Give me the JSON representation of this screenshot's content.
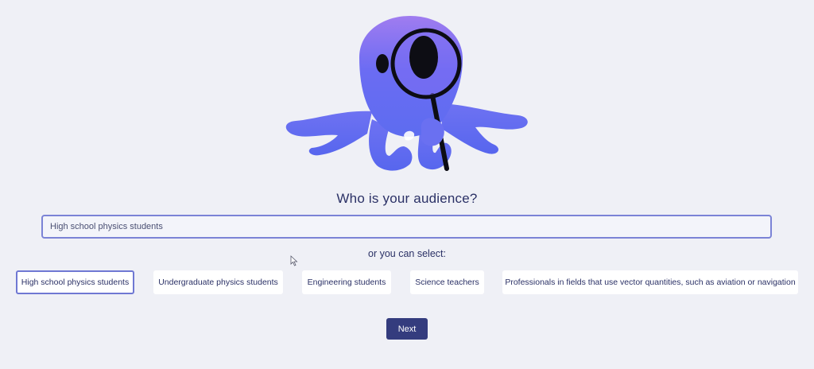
{
  "mascot": {
    "icon": "octopus-with-magnifying-glass-icon"
  },
  "question": {
    "text": "Who is your audience?"
  },
  "audience_input": {
    "value": "High school physics students"
  },
  "options_prompt": {
    "text": "or you can select:"
  },
  "options": [
    {
      "label": "High school physics students",
      "selected": true
    },
    {
      "label": "Undergraduate physics students",
      "selected": false
    },
    {
      "label": "Engineering students",
      "selected": false
    },
    {
      "label": "Science teachers",
      "selected": false
    },
    {
      "label": "Professionals in fields that use vector quantities, such as aviation or navigation",
      "selected": false
    }
  ],
  "actions": {
    "next_label": "Next"
  },
  "colors": {
    "background": "#eff0f6",
    "heading": "#2b3166",
    "accent_border": "#7b83d6",
    "primary_button": "#343c7e",
    "mascot_top": "#9a7cf2",
    "mascot_bottom": "#5f6ef0"
  }
}
